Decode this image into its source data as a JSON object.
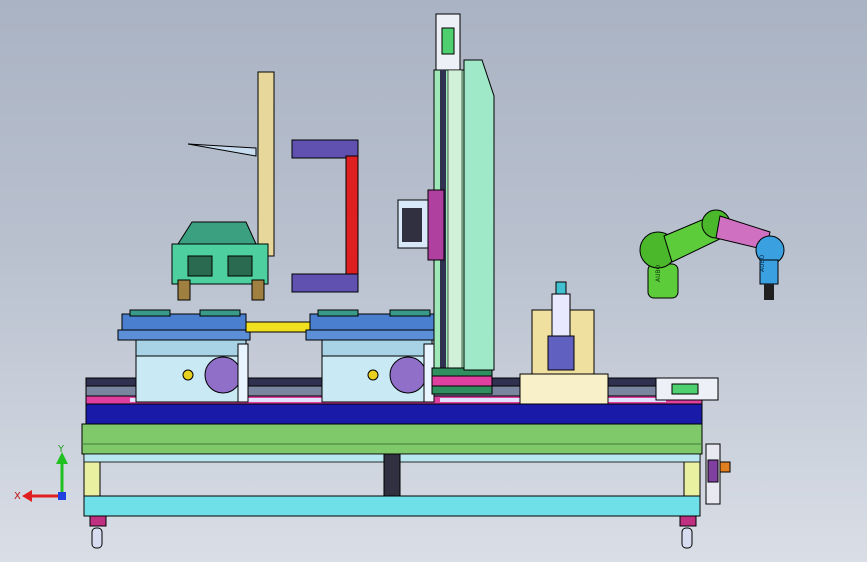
{
  "viewport": {
    "background_top": "#aab3c3",
    "background_bottom": "#d9dee6"
  },
  "triad": {
    "x_label": "X",
    "y_label": "Y",
    "x_color": "#e02020",
    "y_color": "#20c020",
    "z_color": "#2040e0"
  },
  "robot_badge_1": "AUBO",
  "robot_badge_2": "AUBO",
  "colors": {
    "frame_green": "#7fc96a",
    "frame_cyan": "#6fe0e8",
    "base_blue": "#1a1aa8",
    "rail_magenta": "#e040a0",
    "gantry_green": "#9fe8b8",
    "fixture_teal": "#4ecfa0",
    "turntable_light": "#c9eaf5",
    "turntable_blue": "#4a7fd0",
    "robot_green": "#5ccc3a",
    "robot_pink": "#d070c0",
    "robot_blue": "#3aa0e0",
    "beige": "#e8d79a",
    "purple": "#6050b0",
    "red": "#e02020",
    "yellow": "#f0e020"
  }
}
